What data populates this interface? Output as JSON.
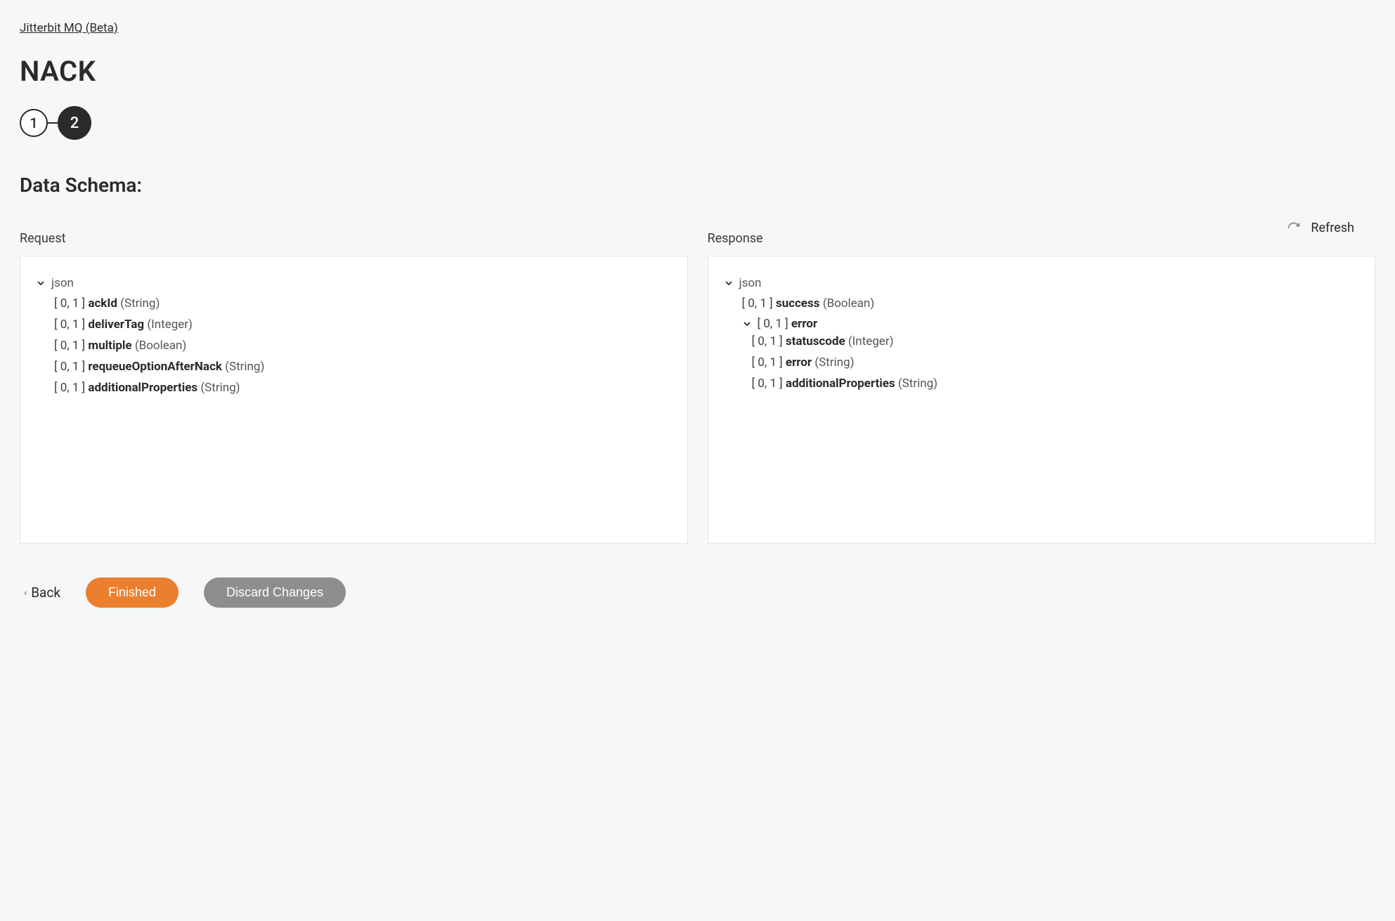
{
  "breadcrumb": {
    "label": "Jitterbit MQ (Beta)"
  },
  "page": {
    "title": "NACK"
  },
  "stepper": {
    "step1": "1",
    "step2": "2"
  },
  "section": {
    "title": "Data Schema:"
  },
  "refresh": {
    "label": "Refresh"
  },
  "request": {
    "label": "Request",
    "root": "json",
    "fields": {
      "f0": {
        "card": "[ 0, 1 ]",
        "name": "ackId",
        "type": "(String)"
      },
      "f1": {
        "card": "[ 0, 1 ]",
        "name": "deliverTag",
        "type": "(Integer)"
      },
      "f2": {
        "card": "[ 0, 1 ]",
        "name": "multiple",
        "type": "(Boolean)"
      },
      "f3": {
        "card": "[ 0, 1 ]",
        "name": "requeueOptionAfterNack",
        "type": "(String)"
      },
      "f4": {
        "card": "[ 0, 1 ]",
        "name": "additionalProperties",
        "type": "(String)"
      }
    }
  },
  "response": {
    "label": "Response",
    "root": "json",
    "fields": {
      "success": {
        "card": "[ 0, 1 ]",
        "name": "success",
        "type": "(Boolean)"
      },
      "error": {
        "card": "[ 0, 1 ]",
        "name": "error"
      },
      "error_children": {
        "statuscode": {
          "card": "[ 0, 1 ]",
          "name": "statuscode",
          "type": "(Integer)"
        },
        "error": {
          "card": "[ 0, 1 ]",
          "name": "error",
          "type": "(String)"
        },
        "additionalProperties": {
          "card": "[ 0, 1 ]",
          "name": "additionalProperties",
          "type": "(String)"
        }
      }
    }
  },
  "footer": {
    "back": "Back",
    "finished": "Finished",
    "discard": "Discard Changes"
  }
}
